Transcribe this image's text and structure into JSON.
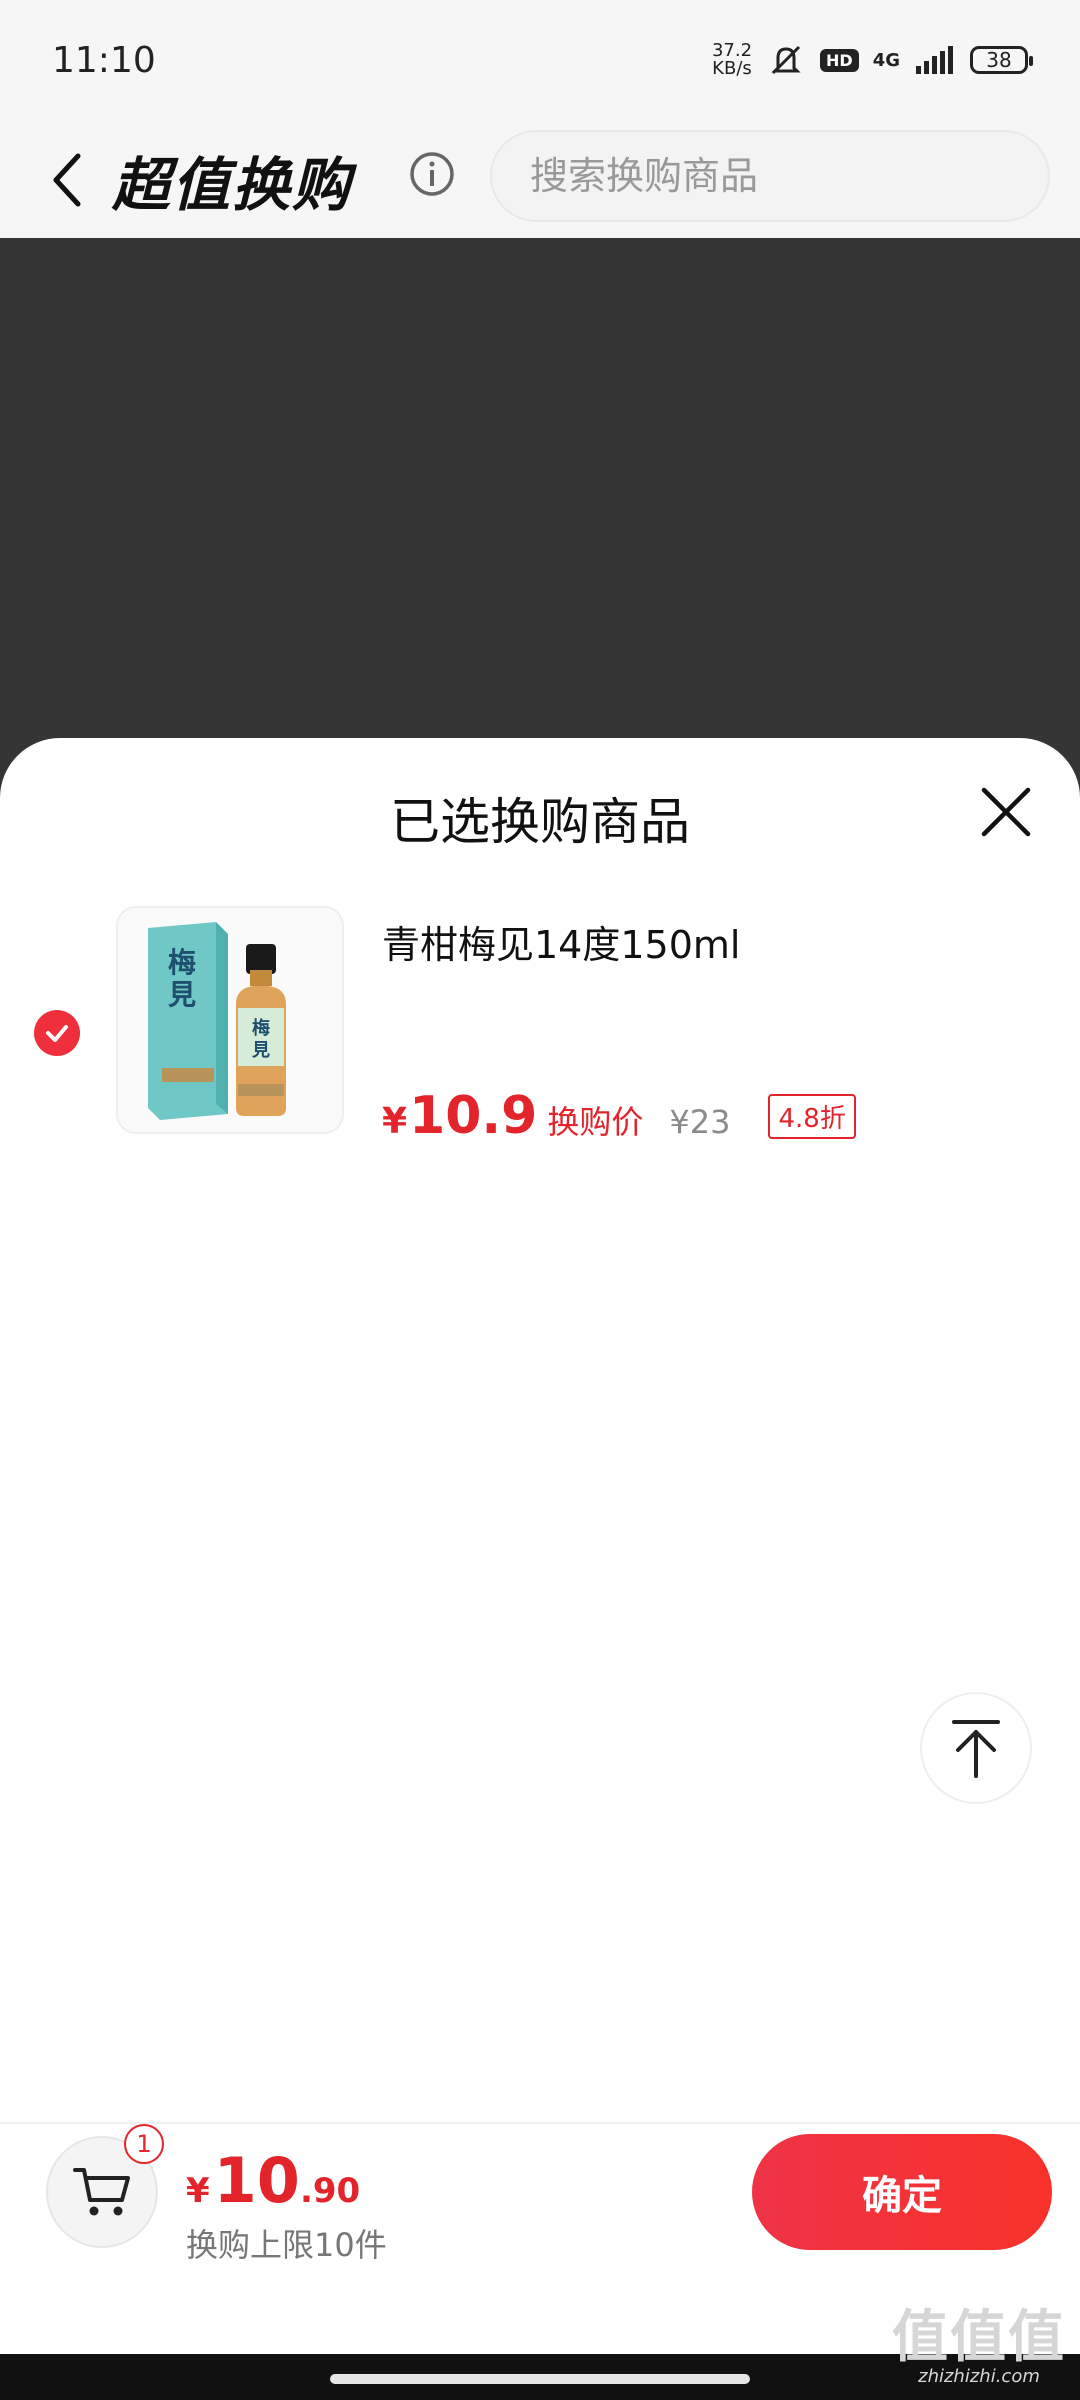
{
  "status_bar": {
    "time": "11:10",
    "net_speed_value": "37.2",
    "net_speed_unit": "KB/s",
    "hd": "HD",
    "network": "4G",
    "battery": "38"
  },
  "header": {
    "title": "超值换购",
    "search_placeholder": "搜索换购商品"
  },
  "sheet": {
    "title": "已选换购商品",
    "items": [
      {
        "name": "青柑梅见14度150ml",
        "currency": "¥",
        "price": "10.9",
        "price_tag": "换购价",
        "original_price": "¥23",
        "discount": "4.8折",
        "selected": true,
        "label_text": "梅見"
      }
    ]
  },
  "bottom_bar": {
    "cart_count": "1",
    "currency": "¥",
    "total_int": "10",
    "total_dec": ".90",
    "limit_text": "换购上限10件",
    "confirm_label": "确定"
  },
  "watermark": {
    "logo": "值值值",
    "url": "zhizhizhi.com"
  },
  "colors": {
    "accent": "#e3242b",
    "overlay": "#353535",
    "thumb_box": "#6fc8c6"
  }
}
